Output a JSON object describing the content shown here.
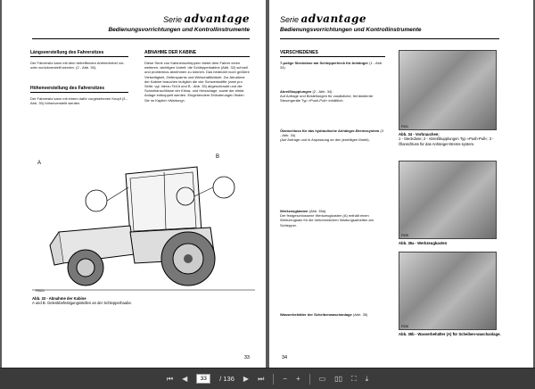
{
  "header": {
    "serie": "Serie",
    "brand": "advantage",
    "subtitle": "Bedienungsvorrichtungen und Kontrollinstrumente"
  },
  "left": {
    "sec1_title": "Längsverstellung des Fahrersitzes",
    "sec1_body": "Der Fahrersitz kann mit dem betreffenden Arretierhebel vor- oder zurückverstellt werden. (2 - Abb. 30).",
    "sec2_title": "Höhenverstellung des Fahrersitzes",
    "sec2_body": "Der Fahrersitz kann mit einem dafür vorgesehenen Knopf (3 - Abb. 30) höhenverstellt werden.",
    "sec3_title": "ABNAHME DER KABINE",
    "sec3_body": "Diese Serie von Kabinenschleppern bietet dem Fahrer einen weiteren, wichtigen Vorteil: die Schlepperkabine (Abb. 32) schnell und problemlos abnehmen zu können. Das bedeutet noch größere Vielseitigkeit, Zeitersparnis und Wirtschaftlichkeit. Zur Abnahme der Kabine brauchen lediglich die vier Schwenkstifte (zwei pro Seite; vgl. hierzu Teil A und B - Abb. 33) abgeschraubt und die Schnellanschlüsse der Klima- und Heizanlage, sowie der elektr. Anlage entkoppelt werden. Eingehendere Erläuterungen finden Sie im Kapitel «Wartung».",
    "fig_code": "F0021",
    "label_a": "A",
    "label_b": "B",
    "caption_title": "Abb. 33 - Abnahme der Kabine",
    "caption_body": "A und B. Gelenkbefestigungsstellen an der Schlepperhaube.",
    "page_number": "33"
  },
  "right": {
    "sec_title": "VERSCHIEDENES",
    "p1_title": "7-polige Steckdose am Schlepperheck für Anhänger",
    "p1_ref": "(1 - Abb. 34)",
    "p2_title": "Abreißkupplungen",
    "p2_ref": "(2 - Abb. 34)",
    "p2_body": "Auf Anfrage und Bestellungen für zusätzliche, fernbediente Steuergeräte Typ «Push-Pull» erhältlich.",
    "p3_title": "Ölanschluss für das hydraulische Anhänger-Bremssystem",
    "p3_ref": "(3 - Abb. 34)",
    "p3_body": "(Auf Anfrage und in Anpassung an den jeweiligen Markt).",
    "p4_title": "Werkzeugkasten",
    "p4_ref": "(Abb. 35a)",
    "p4_body": "Der festgeschlossene Werkzeugkasten (A) enthält einen Werkzeugsatz für die herkömmlichen Wartungsarbeiten am Schlepper.",
    "p5_title": "Wasserbehälter der Scheibenwaschanlage",
    "p5_ref": "(Abb. 35)",
    "cap1_title": "Abb. 34 - Vorbrauchen:",
    "cap1_body": "1 - Steckdose; 2 - Abreißkupplungen Typ «Push-Pull»; 3 - Ölanschluss für das Anhänger-Brems-system.",
    "cap2_title": "Abb. 35a - Werkzeugkasten",
    "cap3_title": "Abb. 35b - Wasserbehälter (A) für Scheiben-waschanlage.",
    "photo1_code": "F001",
    "photo2_code": "F025",
    "photo3_code": "F026",
    "page_number": "34"
  },
  "toolbar": {
    "current_page": "33",
    "total_pages": "/ 136"
  }
}
